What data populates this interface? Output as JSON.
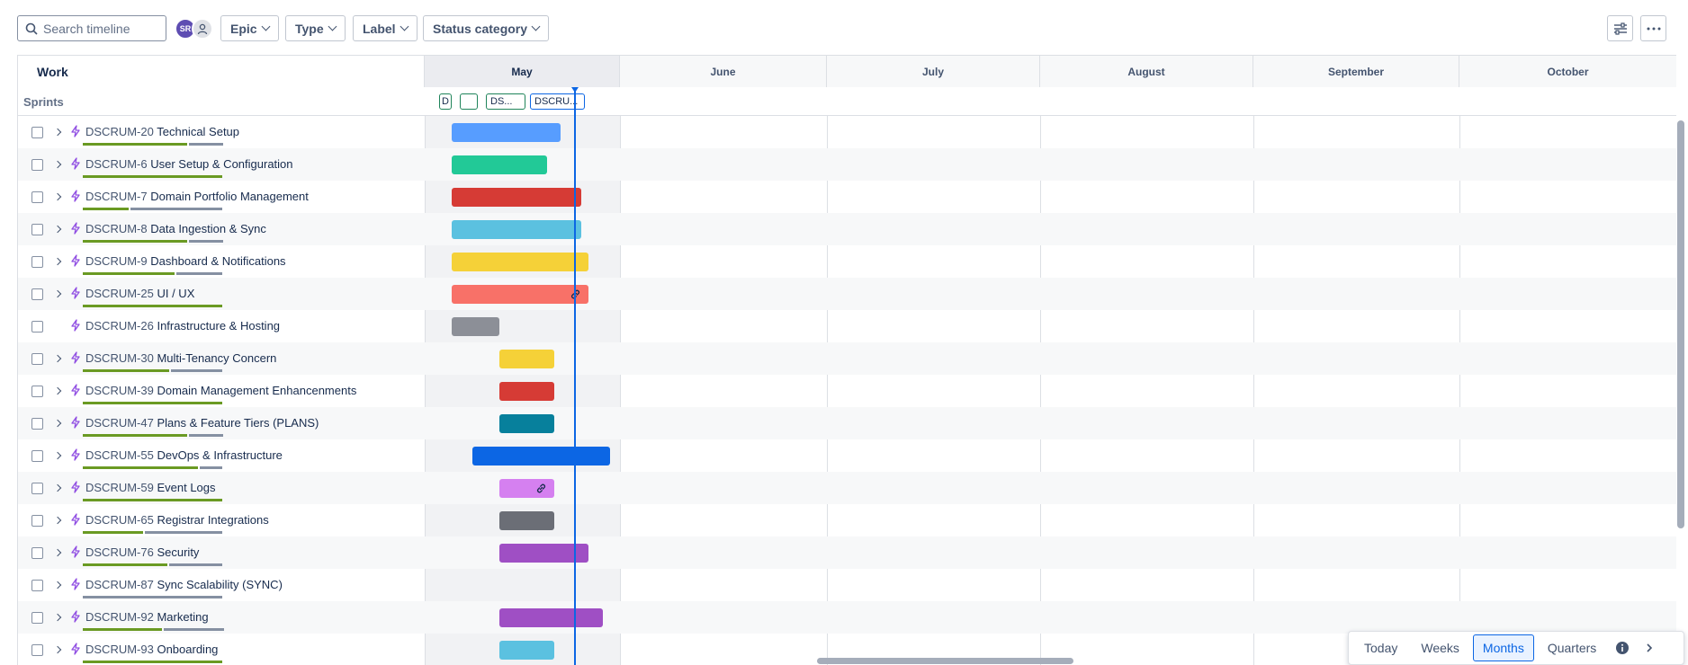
{
  "toolbar": {
    "search_placeholder": "Search timeline",
    "avatar_initials": "SR",
    "filters": [
      "Epic",
      "Type",
      "Label",
      "Status category"
    ]
  },
  "grid": {
    "work_header": "Work",
    "months": [
      "May",
      "June",
      "July",
      "August",
      "September",
      "October"
    ],
    "sprints_label": "Sprints",
    "sprint_chips": [
      "D",
      "",
      "DS...",
      "DSCRU..."
    ]
  },
  "rows": [
    {
      "key": "DSCRUM-20",
      "title": "Technical Setup",
      "expandable": true,
      "color": "#579dff",
      "link": false
    },
    {
      "key": "DSCRUM-6",
      "title": "User Setup & Configuration",
      "expandable": true,
      "color": "#22c997",
      "link": false
    },
    {
      "key": "DSCRUM-7",
      "title": "Domain Portfolio Management",
      "expandable": true,
      "color": "#d63b35",
      "link": false
    },
    {
      "key": "DSCRUM-8",
      "title": "Data Ingestion & Sync",
      "expandable": true,
      "color": "#5bc1e0",
      "link": false
    },
    {
      "key": "DSCRUM-9",
      "title": "Dashboard & Notifications",
      "expandable": true,
      "color": "#f5d138",
      "link": false
    },
    {
      "key": "DSCRUM-25",
      "title": "UI / UX",
      "expandable": true,
      "color": "#f87168",
      "link": true
    },
    {
      "key": "DSCRUM-26",
      "title": "Infrastructure & Hosting",
      "expandable": false,
      "color": "#8c8f97",
      "link": false
    },
    {
      "key": "DSCRUM-30",
      "title": "Multi-Tenancy Concern",
      "expandable": true,
      "color": "#f5d138",
      "link": false
    },
    {
      "key": "DSCRUM-39",
      "title": "Domain Management Enhancenments",
      "expandable": true,
      "color": "#d63b35",
      "link": false
    },
    {
      "key": "DSCRUM-47",
      "title": "Plans & Feature Tiers (PLANS)",
      "expandable": true,
      "color": "#07809c",
      "link": false
    },
    {
      "key": "DSCRUM-55",
      "title": "DevOps & Infrastructure",
      "expandable": true,
      "color": "#0c66e4",
      "link": false
    },
    {
      "key": "DSCRUM-59",
      "title": "Event Logs",
      "expandable": true,
      "color": "#d580f0",
      "link": true
    },
    {
      "key": "DSCRUM-65",
      "title": "Registrar Integrations",
      "expandable": true,
      "color": "#6b6e76",
      "link": false
    },
    {
      "key": "DSCRUM-76",
      "title": "Security",
      "expandable": true,
      "color": "#9f4fc4",
      "link": false
    },
    {
      "key": "DSCRUM-87",
      "title": "Sync Scalability (SYNC)",
      "expandable": true,
      "color": "",
      "link": false
    },
    {
      "key": "DSCRUM-92",
      "title": "Marketing",
      "expandable": true,
      "color": "#9f4fc4",
      "link": false
    },
    {
      "key": "DSCRUM-93",
      "title": "Onboarding",
      "expandable": true,
      "color": "#5bc1e0",
      "link": false
    }
  ],
  "zoom": {
    "options": [
      "Today",
      "Weeks",
      "Months",
      "Quarters"
    ],
    "selected": "Months"
  }
}
